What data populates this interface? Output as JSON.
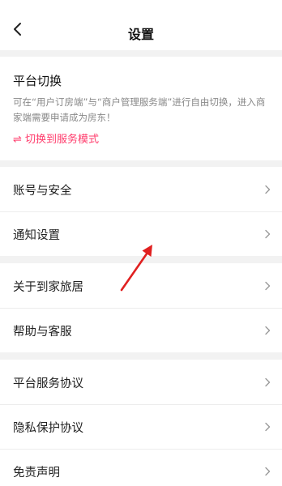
{
  "header": {
    "title": "设置"
  },
  "platform": {
    "title": "平台切换",
    "description": "可在“用户订房端”与“商户管理服务端”进行自由切换，进入商家端需要申请成为房东！",
    "switch_link": "⇌ 切换到服务模式"
  },
  "groups": [
    {
      "items": [
        {
          "label": "账号与安全"
        },
        {
          "label": "通知设置"
        }
      ]
    },
    {
      "items": [
        {
          "label": "关于到家旅居"
        },
        {
          "label": "帮助与客服"
        }
      ]
    },
    {
      "items": [
        {
          "label": "平台服务协议"
        },
        {
          "label": "隐私保护协议"
        },
        {
          "label": "免责声明"
        }
      ]
    }
  ],
  "colors": {
    "accent": "#ff3b6b",
    "annotation_arrow": "#e02020"
  }
}
